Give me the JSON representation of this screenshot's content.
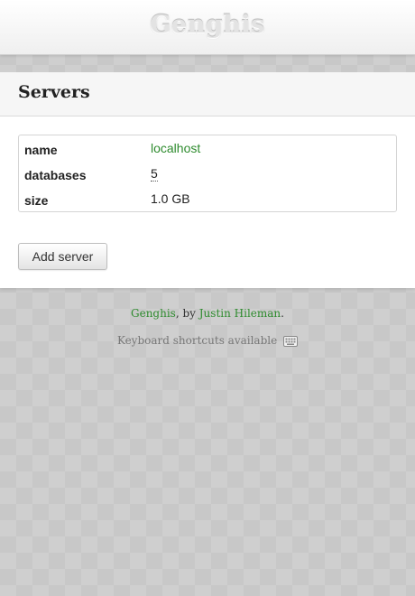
{
  "header": {
    "app_title": "Genghis"
  },
  "section": {
    "title": "Servers"
  },
  "server": {
    "fields": [
      {
        "key": "name",
        "value": "localhost"
      },
      {
        "key": "databases",
        "value": "5"
      },
      {
        "key": "size",
        "value": "1.0 GB"
      }
    ]
  },
  "actions": {
    "add_server_label": "Add server"
  },
  "footer": {
    "product_link": "Genghis",
    "by_text": ", by ",
    "author_link": "Justin Hileman",
    "period": ".",
    "shortcuts_text": "Keyboard shortcuts available",
    "shortcuts_icon": "keyboard-icon"
  },
  "colors": {
    "link": "#2e8b2e",
    "background": "#cfcfcf",
    "panel": "#ffffff"
  }
}
